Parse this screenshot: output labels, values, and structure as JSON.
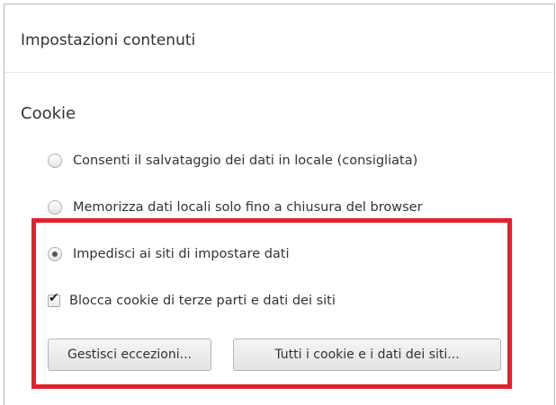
{
  "dialog": {
    "title": "Impostazioni contenuti"
  },
  "cookies": {
    "section_title": "Cookie",
    "options": [
      {
        "label": "Consenti il salvataggio dei dati in locale (consigliata)",
        "selected": false
      },
      {
        "label": "Memorizza dati locali solo fino a chiusura del browser",
        "selected": false
      },
      {
        "label": "Impedisci ai siti di impostare dati",
        "selected": true
      }
    ],
    "block_third_party": {
      "label": "Blocca cookie di terze parti e dati dei siti",
      "checked": true,
      "check_glyph": "✔"
    },
    "buttons": {
      "manage_exceptions": "Gestisci eccezioni...",
      "all_cookies": "Tutti i cookie e i dati dei siti..."
    }
  },
  "colors": {
    "highlight": "#e0212e"
  }
}
